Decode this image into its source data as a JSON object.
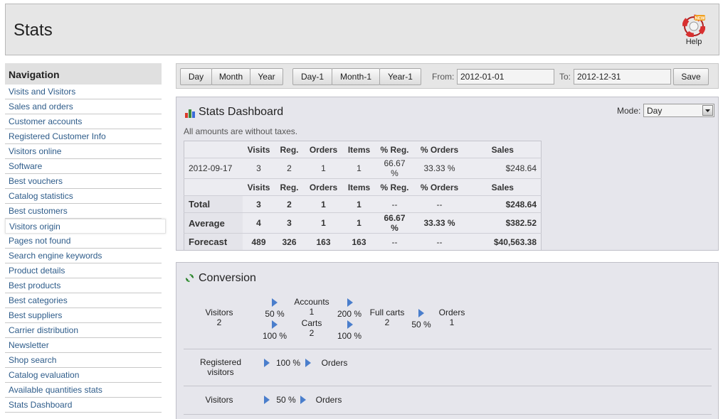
{
  "header": {
    "title": "Stats",
    "help_label": "Help",
    "new_badge": "NEW"
  },
  "sidebar": {
    "title": "Navigation",
    "items": [
      {
        "label": "Visits and Visitors"
      },
      {
        "label": "Sales and orders"
      },
      {
        "label": "Customer accounts"
      },
      {
        "label": "Registered Customer Info"
      },
      {
        "label": "Visitors online"
      },
      {
        "label": "Software"
      },
      {
        "label": "Best vouchers"
      },
      {
        "label": "Catalog statistics"
      },
      {
        "label": "Best customers"
      },
      {
        "label": "Visitors origin"
      },
      {
        "label": "Pages not found"
      },
      {
        "label": "Search engine keywords"
      },
      {
        "label": "Product details"
      },
      {
        "label": "Best products"
      },
      {
        "label": "Best categories"
      },
      {
        "label": "Best suppliers"
      },
      {
        "label": "Carrier distribution"
      },
      {
        "label": "Newsletter"
      },
      {
        "label": "Shop search"
      },
      {
        "label": "Catalog evaluation"
      },
      {
        "label": "Available quantities stats"
      },
      {
        "label": "Stats Dashboard"
      }
    ],
    "active_index": 9
  },
  "toolbar": {
    "day": "Day",
    "month": "Month",
    "year": "Year",
    "day_1": "Day-1",
    "month_1": "Month-1",
    "year_1": "Year-1",
    "from_label": "From:",
    "from_value": "2012-01-01",
    "to_label": "To:",
    "to_value": "2012-12-31",
    "save": "Save"
  },
  "dashboard": {
    "title": "Stats Dashboard",
    "mode_label": "Mode:",
    "mode_value": "Day",
    "note": "All amounts are without taxes.",
    "headers": [
      "",
      "Visits",
      "Reg.",
      "Orders",
      "Items",
      "% Reg.",
      "% Orders",
      "Sales"
    ],
    "day_row": [
      "2012-09-17",
      "3",
      "2",
      "1",
      "1",
      "66.67 %",
      "33.33 %",
      "$248.64"
    ],
    "summary_rows": [
      [
        "Total",
        "3",
        "2",
        "1",
        "1",
        "--",
        "--",
        "$248.64"
      ],
      [
        "Average",
        "4",
        "3",
        "1",
        "1",
        "66.67 %",
        "33.33 %",
        "$382.52"
      ],
      [
        "Forecast",
        "489",
        "326",
        "163",
        "163",
        "--",
        "--",
        "$40,563.38"
      ]
    ]
  },
  "conversion": {
    "title": "Conversion",
    "visitors": "Visitors",
    "visitors_count": "2",
    "pct_visitors_accounts": "50 %",
    "pct_visitors_carts": "100 %",
    "accounts": "Accounts",
    "accounts_count": "1",
    "carts": "Carts",
    "carts_count": "2",
    "pct_accounts_fullcarts": "200 %",
    "pct_carts_fullcarts": "100 %",
    "full_carts": "Full carts",
    "full_carts_count": "2",
    "pct_fullcarts_orders": "50 %",
    "orders": "Orders",
    "orders_count": "1",
    "registered_visitors": "Registered visitors",
    "pct_registered_orders": "100 %",
    "orders_b": "Orders",
    "visitors_c": "Visitors",
    "pct_visitors_orders": "50 %",
    "orders_c": "Orders"
  }
}
